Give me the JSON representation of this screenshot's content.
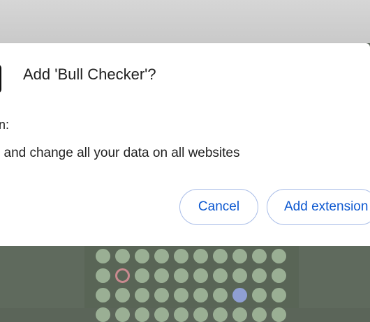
{
  "dialog": {
    "title": "Add 'Bull Checker'?",
    "permissions_label": "n:",
    "permissions": [
      "l and change all your data on all websites"
    ],
    "cancel_label": "Cancel",
    "add_label": "Add extension"
  },
  "colors": {
    "accent": "#0b57d0",
    "button_border": "#a9bde8",
    "dot_default": "#9aaf94",
    "dot_highlight": "#8f9fd2",
    "dot_ring": "#c98a8f",
    "board_bg": "#5f6a5d"
  },
  "icons": {
    "extension": "extension-icon"
  },
  "board": {
    "rows": [
      [
        "dot",
        "dot",
        "dot",
        "dot",
        "dot",
        "dot",
        "dot",
        "dot",
        "dot",
        "dot"
      ],
      [
        "dot",
        "ring",
        "dot",
        "dot",
        "dot",
        "dot",
        "dot",
        "dot",
        "dot",
        "dot"
      ],
      [
        "dot",
        "dot",
        "dot",
        "dot",
        "dot",
        "dot",
        "dot",
        "highlight",
        "dot",
        "dot"
      ],
      [
        "partial",
        "partial",
        "partial",
        "partial",
        "partial",
        "partial",
        "partial",
        "partial",
        "partial",
        "partial"
      ]
    ]
  }
}
